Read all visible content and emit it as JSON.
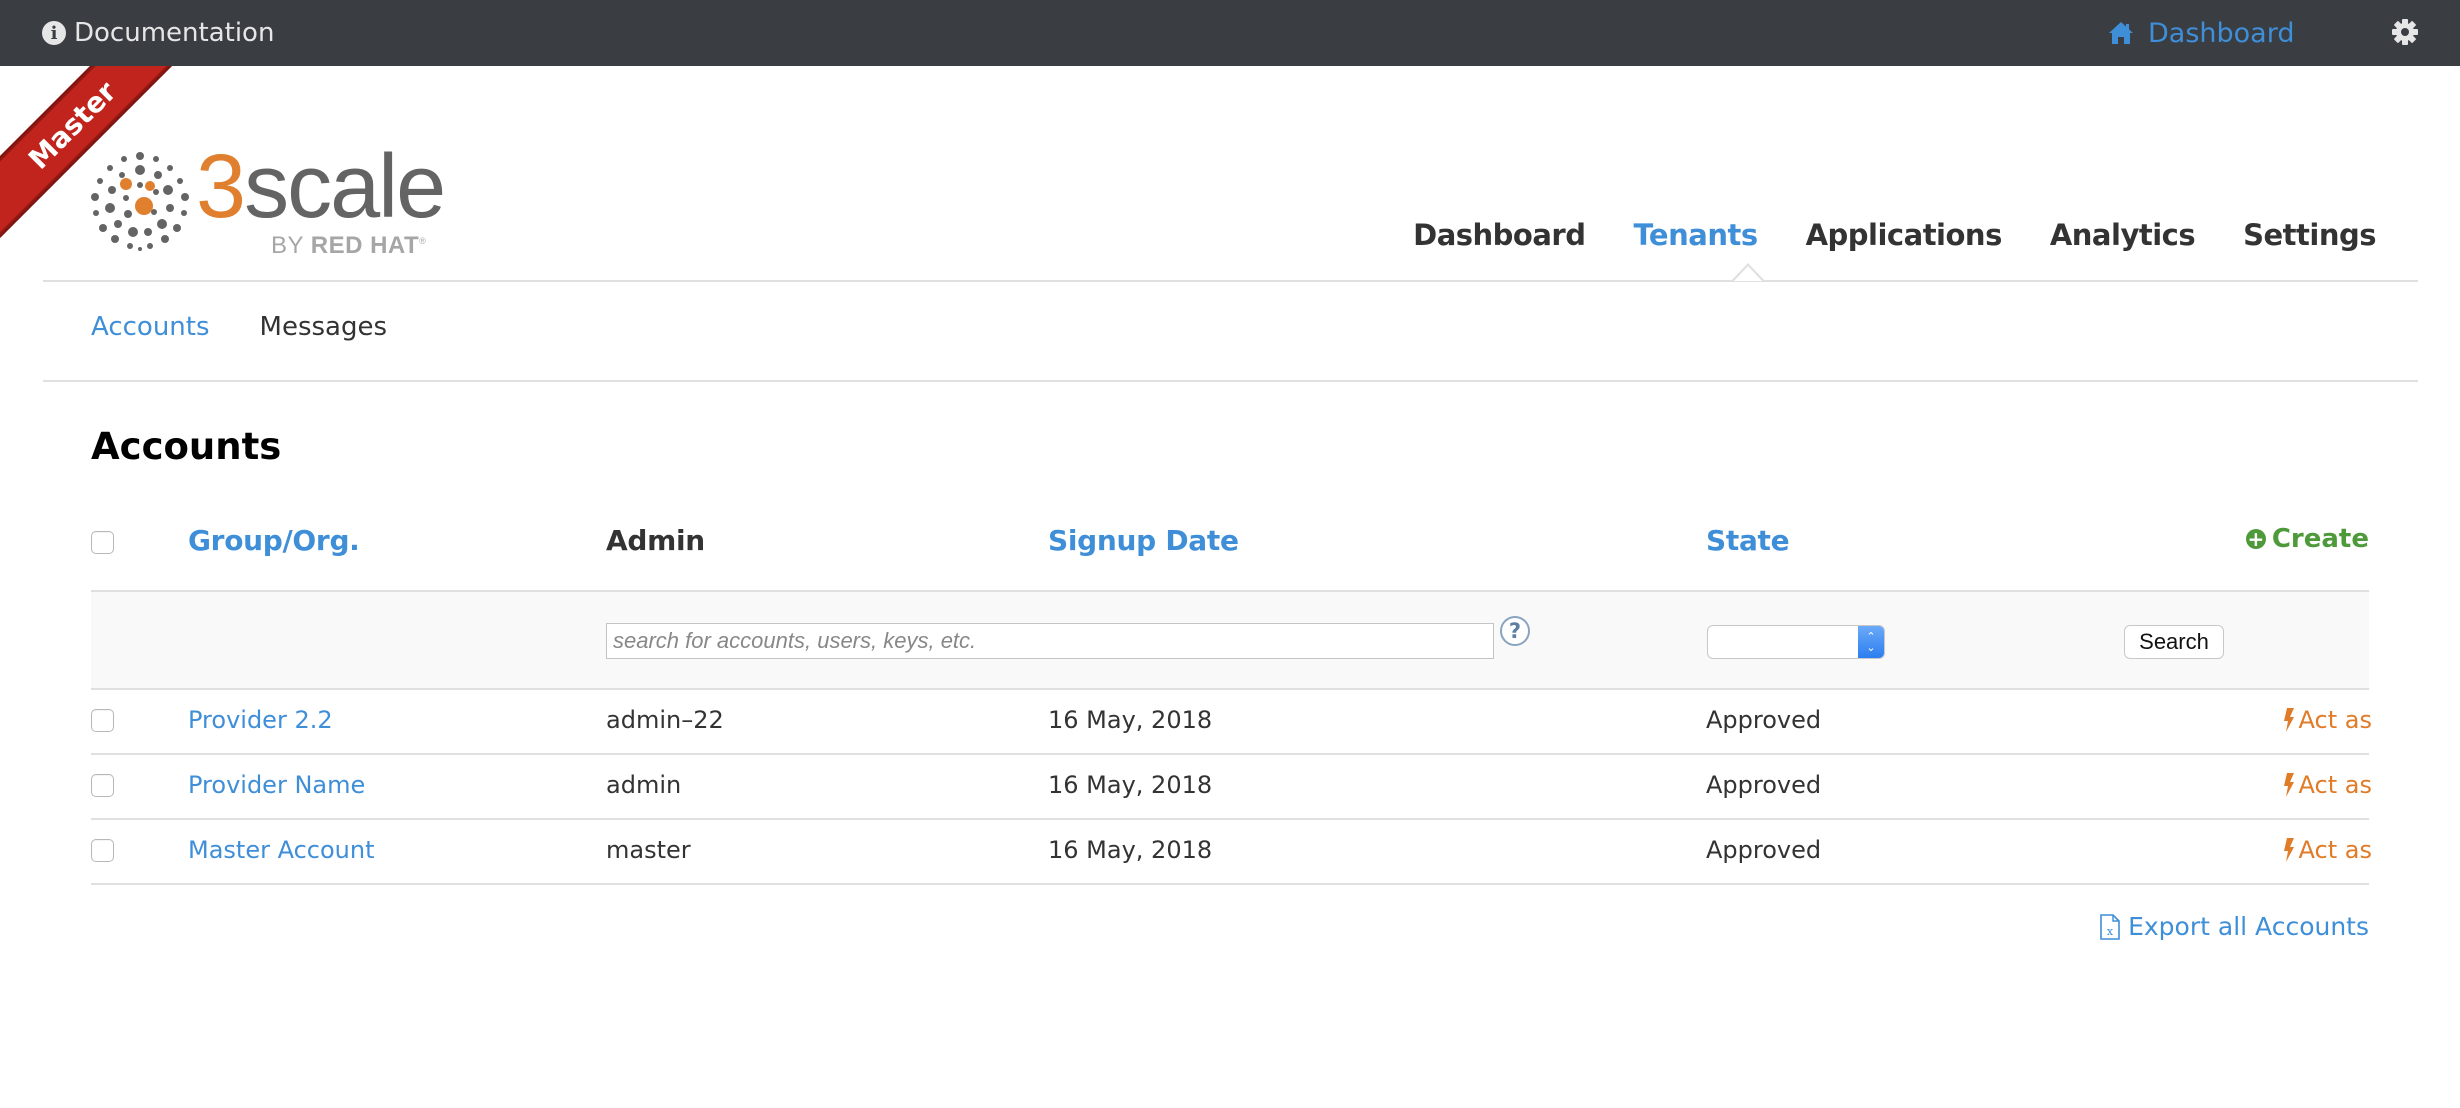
{
  "topbar": {
    "documentation_label": "Documentation",
    "dashboard_label": "Dashboard"
  },
  "ribbon": {
    "label": "Master"
  },
  "logo": {
    "word_accent": "3",
    "word_rest": "scale",
    "by_prefix": "BY ",
    "by_brand": "RED HAT",
    "registered": "®"
  },
  "main_nav": {
    "items": [
      {
        "label": "Dashboard",
        "active": false
      },
      {
        "label": "Tenants",
        "active": true
      },
      {
        "label": "Applications",
        "active": false
      },
      {
        "label": "Analytics",
        "active": false
      },
      {
        "label": "Settings",
        "active": false
      }
    ]
  },
  "sub_nav": {
    "items": [
      {
        "label": "Accounts",
        "active": true
      },
      {
        "label": "Messages",
        "active": false
      }
    ]
  },
  "page": {
    "title": "Accounts"
  },
  "table": {
    "columns": [
      {
        "label": "Group/Org.",
        "sortable": true
      },
      {
        "label": "Admin",
        "sortable": false
      },
      {
        "label": "Signup Date",
        "sortable": true
      },
      {
        "label": "State",
        "sortable": true
      }
    ],
    "create_label": "Create",
    "filter": {
      "search_placeholder": "search for accounts, users, keys, etc.",
      "search_value": "",
      "help_glyph": "?",
      "state_selected": "",
      "search_button": "Search"
    },
    "rows": [
      {
        "group": "Provider 2.2",
        "admin": "admin–22",
        "signup": "16 May, 2018",
        "state": "Approved",
        "action": "Act as"
      },
      {
        "group": "Provider Name",
        "admin": "admin",
        "signup": "16 May, 2018",
        "state": "Approved",
        "action": "Act as"
      },
      {
        "group": "Master Account",
        "admin": "master",
        "signup": "16 May, 2018",
        "state": "Approved",
        "action": "Act as"
      }
    ]
  },
  "export_label": "Export all Accounts",
  "colors": {
    "topbar_bg": "#3a3e43",
    "link_blue": "#3f8ed8",
    "create_green": "#4e9a3b",
    "act_orange": "#e07b28",
    "ribbon_red": "#c0241c",
    "logo_orange": "#e07f2e"
  }
}
